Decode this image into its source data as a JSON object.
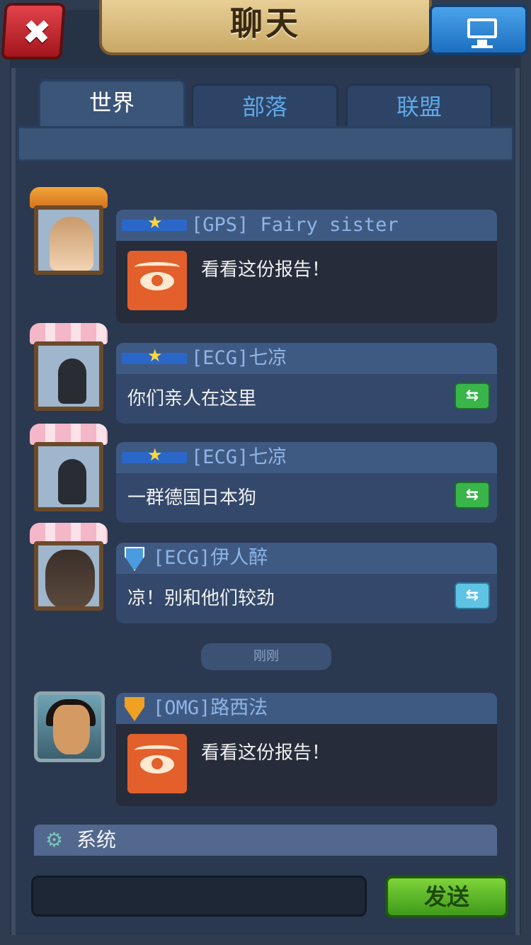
{
  "header": {
    "title": "聊天",
    "close_icon_glyph": "✖",
    "screen_icon": "monitor-icon"
  },
  "tabs": [
    {
      "label": "世界",
      "active": true
    },
    {
      "label": "部落",
      "active": false
    },
    {
      "label": "联盟",
      "active": false
    }
  ],
  "messages": [
    {
      "name": "[GPS] Fairy sister",
      "text": "看看这份报告！",
      "type": "report",
      "frame": "dog"
    },
    {
      "name": "[ECG]七凉",
      "text": "你们亲人在这里",
      "type": "text",
      "frame": "flower",
      "translate": "green"
    },
    {
      "name": "[ECG]七凉",
      "text": "一群德国日本狗",
      "type": "text",
      "frame": "flower",
      "translate": "green"
    },
    {
      "name": "[ECG]伊人醉",
      "text": "凉！别和他们较劲",
      "type": "text",
      "frame": "flower",
      "translate": "cyan"
    },
    {
      "name": "[OMG]路西法",
      "text": "看看这份报告！",
      "type": "report",
      "frame": "hero"
    }
  ],
  "timestamp": "刚刚",
  "system": {
    "label": "系统"
  },
  "composer": {
    "placeholder": "",
    "send_label": "发送"
  },
  "translate_glyph": "⇆",
  "colors": {
    "accent_green": "#39b54a",
    "accent_cyan": "#5fc3e4",
    "tab_active": "#3b5578"
  }
}
